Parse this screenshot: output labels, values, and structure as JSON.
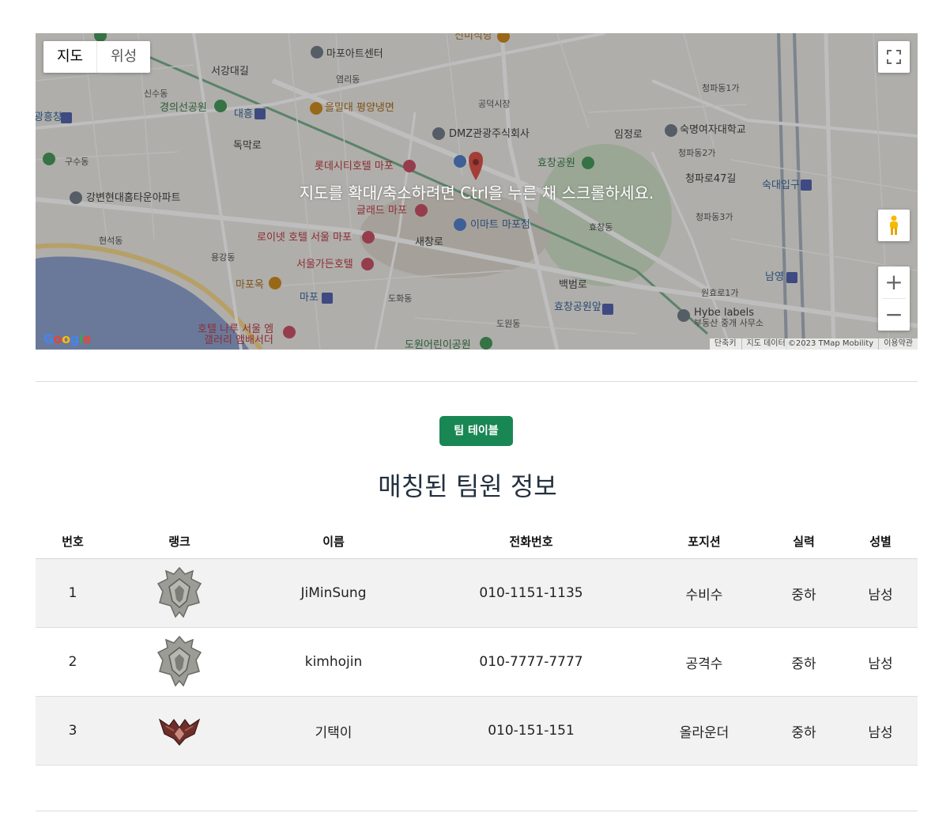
{
  "map": {
    "type_buttons": [
      "지도",
      "위성"
    ],
    "overlay_message": "지도를 확대/축소하려면 Ctrl을 누른 채 스크롤하세요.",
    "zoom_in": "+",
    "zoom_out": "−",
    "attribution": [
      "단축키",
      "지도 데이터 ©2023 TMap Mobility",
      "이용약관"
    ],
    "logo": "Google",
    "labels": {
      "l1": "마포아트센터",
      "l2": "신미식당",
      "l3": "을밀대 평양냉면",
      "l4": "경의선공원",
      "l5": "DMZ관광주식회사",
      "l6": "숙명여자대학교",
      "l7": "롯데시티호텔 마포",
      "l8": "효창공원",
      "l9": "강변현대홈타운아파트",
      "l10": "글래드 마포",
      "l11": "이마트 마포점",
      "l12": "로이넷 호텔 서울 마포",
      "l13": "서울가든호텔",
      "l14": "마포옥",
      "l15": "마포",
      "l16": "효창공원앞",
      "l17": "Hybe labels",
      "l18": "부동산 중개 사무소",
      "l19": "호텔 나루 서울 엠",
      "l20": "갤러리 앰배서더",
      "l21": "대흥",
      "l22": "숙대입구",
      "l23": "남영",
      "l24": "공덕시장",
      "l25": "도원어린이공원",
      "l26": "구수동",
      "l27": "현석동",
      "l28": "염리동",
      "l29": "청파동1가",
      "l30": "청파동2가",
      "l31": "청파동3가",
      "l32": "원효로1가",
      "l33": "도화동",
      "l34": "도원동",
      "l35": "용강동",
      "l36": "신수동",
      "l37": "효창동",
      "l38": "임정로",
      "l39": "새창로",
      "l40": "백범로",
      "l41": "독막로",
      "l42": "광흥창",
      "l43": "서강대길",
      "l44": "청파로47길"
    }
  },
  "section": {
    "badge": "팀 테이블",
    "title": "매칭된 팀원 정보"
  },
  "table": {
    "headers": [
      "번호",
      "랭크",
      "이름",
      "전화번호",
      "포지션",
      "실력",
      "성별"
    ],
    "rows": [
      {
        "no": "1",
        "rank_icon": "platinum-rank-icon",
        "name": "JiMinSung",
        "phone": "010-1151-1135",
        "position": "수비수",
        "skill": "중하",
        "gender": "남성"
      },
      {
        "no": "2",
        "rank_icon": "platinum-rank-icon",
        "name": "kimhojin",
        "phone": "010-7777-7777",
        "position": "공격수",
        "skill": "중하",
        "gender": "남성"
      },
      {
        "no": "3",
        "rank_icon": "bronze-rank-icon",
        "name": "기택이",
        "phone": "010-151-151",
        "position": "올라운더",
        "skill": "중하",
        "gender": "남성"
      }
    ]
  },
  "colors": {
    "badge_bg": "#198754",
    "phone_link": "#1010e0",
    "title": "#23313f"
  }
}
